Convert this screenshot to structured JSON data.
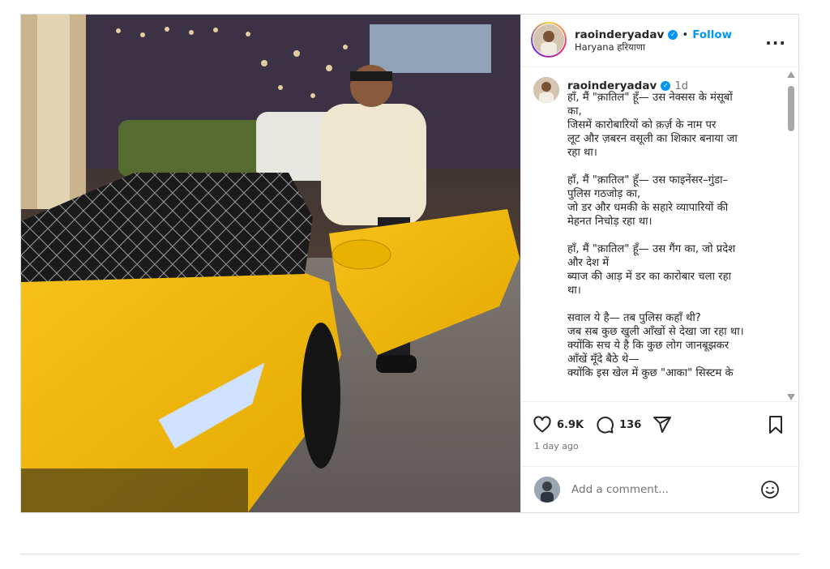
{
  "header": {
    "username": "raoinderyadav",
    "dot": "•",
    "follow": "Follow",
    "location": "Haryana हरियाणा",
    "more": "..."
  },
  "caption": {
    "username": "raoinderyadav",
    "time": "1d",
    "text": "हाँ, मैं \"क़ातिल\" हूँ— उस नेक्सस के मंसूबों\nका,\nजिसमें कारोबारियों को क़र्ज़ के नाम पर\nलूट और ज़बरन वसूली का शिकार बनाया जा\nरहा था।\n\nहाँ, मैं \"क़ातिल\" हूँ— उस फाइनेंसर–गुंडा–\nपुलिस गठजोड़ का,\nजो डर और धमकी के सहारे व्यापारियों की\nमेहनत निचोड़ रहा था।\n\nहाँ, मैं \"क़ातिल\" हूँ— उस गैंग का, जो प्रदेश\nऔर देश में\nब्याज की आड़ में डर का कारोबार चला रहा\nथा।\n\nसवाल ये है— तब पुलिस कहाँ थी?\nजब सब कुछ खुली आँखों से देखा जा रहा था।\nक्योंकि सच ये है कि कुछ लोग जानबूझकर\nआँखें मूँदे बैठे थे—\nक्योंकि इस खेल में कुछ \"आका\" सिस्टम के"
  },
  "actions": {
    "likes": "6.9K",
    "comments": "136",
    "ago": "1 day ago"
  },
  "comment_box": {
    "placeholder": "Add a comment..."
  },
  "icons": {
    "like": "heart-icon",
    "comment": "comment-icon",
    "share": "share-icon",
    "save": "bookmark-icon",
    "emoji": "emoji-icon",
    "verified": "verified-badge-icon"
  },
  "colors": {
    "link": "#0095f6",
    "muted": "#737373",
    "border": "#dbdbdb"
  }
}
